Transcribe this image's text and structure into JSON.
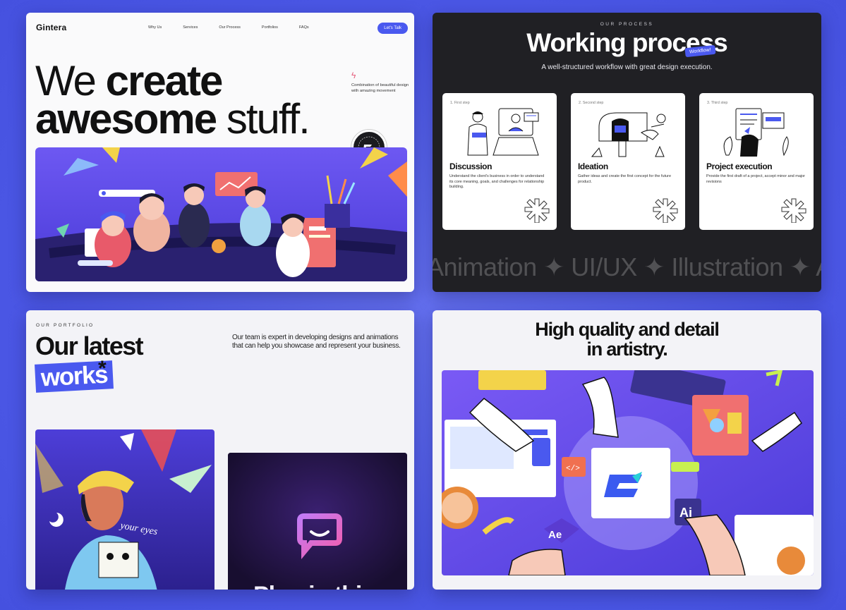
{
  "panel_hero": {
    "logo": "Gintera",
    "nav": [
      "Why Us",
      "Services",
      "Our Process",
      "Portfolios",
      "FAQs"
    ],
    "cta": "Let's Talk",
    "title_line1_light": "We ",
    "title_line1_bold": "create",
    "title_line2_bold": "awesome",
    "title_line2_light": " stuff.",
    "side_note": "Combination of beautiful design with amazing movement"
  },
  "panel_process": {
    "eyebrow": "OUR PROCESS",
    "title": "Working process",
    "badge": "Workflow!",
    "subtitle": "A well-structured workflow with great design execution.",
    "cards": [
      {
        "step": "1. First step",
        "title": "Discussion",
        "desc": "Understand the client's business in order to understand its core meaning, goals, and challenges for relationship building."
      },
      {
        "step": "2. Second step",
        "title": "Ideation",
        "desc": "Gather ideas and create the first concept for the future product."
      },
      {
        "step": "3. Third step",
        "title": "Project execution",
        "desc": "Provide the first draft of a project, accept minor and major revisions"
      }
    ],
    "marquee": "Animation ✦ UI/UX ✦ Illustration ✦ Ani"
  },
  "panel_portfolio": {
    "eyebrow": "OUR PORTFOLIO",
    "title": "Our latest",
    "tag": "works",
    "asterisk": "*",
    "desc": "Our team is expert in developing designs and animations that can help you showcase and represent your business.",
    "shirt_text": "your eyes",
    "card2_label": "Plug in thi"
  },
  "panel_quality": {
    "title_line1": "High quality and detail",
    "title_line2": "in artistry."
  },
  "colors": {
    "background": "#4f5ce8",
    "accent": "#4a59ef",
    "dark_panel": "#202024"
  }
}
